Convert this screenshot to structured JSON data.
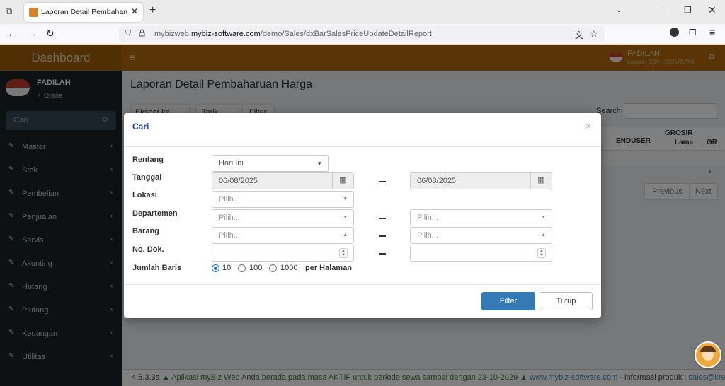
{
  "browser": {
    "tab_title": "Laporan Detail Pembaharuan H",
    "url_prefix": "mybizweb.",
    "url_domain": "mybiz-software.com",
    "url_path": "/demo/Sales/dxBarSalesPriceUpdateDetailReport"
  },
  "topbar": {
    "brand": "Dashboard",
    "menu_icon": "hamburger-icon",
    "user_name": "FADILAH",
    "user_location": "Lokasi : SBY - SURABAYA",
    "settings_icon": "gears-icon"
  },
  "sidebar": {
    "user_name": "FADILAH",
    "status": "Online",
    "status_color": "#3c763d",
    "search_placeholder": "Cari...",
    "items": [
      {
        "label": "Master",
        "icon": "edit-icon"
      },
      {
        "label": "Stok",
        "icon": "edit-icon"
      },
      {
        "label": "Pembelian",
        "icon": "edit-icon"
      },
      {
        "label": "Penjualan",
        "icon": "edit-icon"
      },
      {
        "label": "Servis",
        "icon": "edit-icon"
      },
      {
        "label": "Akunting",
        "icon": "edit-icon"
      },
      {
        "label": "Hutang",
        "icon": "edit-icon"
      },
      {
        "label": "Piutang",
        "icon": "edit-icon"
      },
      {
        "label": "Keuangan",
        "icon": "edit-icon"
      },
      {
        "label": "Utilitas",
        "icon": "edit-icon"
      }
    ]
  },
  "page": {
    "title": "Laporan Detail Pembaharuan Harga",
    "buttons": [
      "Ekspor ke Excel",
      "Tarik Data",
      "Filter"
    ],
    "search_label": "Search:",
    "table_headers": [
      "ENDUSER",
      "GROSIR",
      "Lama",
      "GR"
    ],
    "pagination": [
      "Previous",
      "Next"
    ]
  },
  "modal": {
    "title": "Cari",
    "close": "×",
    "fields": {
      "rentang": {
        "label": "Rentang",
        "value": "Hari Ini"
      },
      "tanggal": {
        "label": "Tanggal",
        "from": "06/08/2025",
        "to": "06/08/2025"
      },
      "lokasi": {
        "label": "Lokasi",
        "placeholder": "Pilih..."
      },
      "departemen": {
        "label": "Departemen",
        "placeholder_from": "Pilih...",
        "placeholder_to": "Pilih..."
      },
      "barang": {
        "label": "Barang",
        "placeholder_from": "Pilih...",
        "placeholder_to": "Pilih..."
      },
      "no_dok": {
        "label": "No. Dok.",
        "from": "",
        "to": ""
      },
      "jumlah_baris": {
        "label": "Jumlah Baris",
        "options": [
          "10",
          "100",
          "1000"
        ],
        "selected": "10",
        "suffix": "per Halaman"
      }
    },
    "filter_button": "Filter",
    "close_button": "Tutup",
    "primary_color": "#337ab7"
  },
  "footer": {
    "version": "4.5.3.3a",
    "notice": "Aplikasi myBiz Web Anda berada pada masa AKTIF untuk periode sewa sampai dengan 23-10-2029",
    "website": "www.mybiz-software.com",
    "info_text": " - informasi produk : ",
    "email": "sales@kre"
  }
}
